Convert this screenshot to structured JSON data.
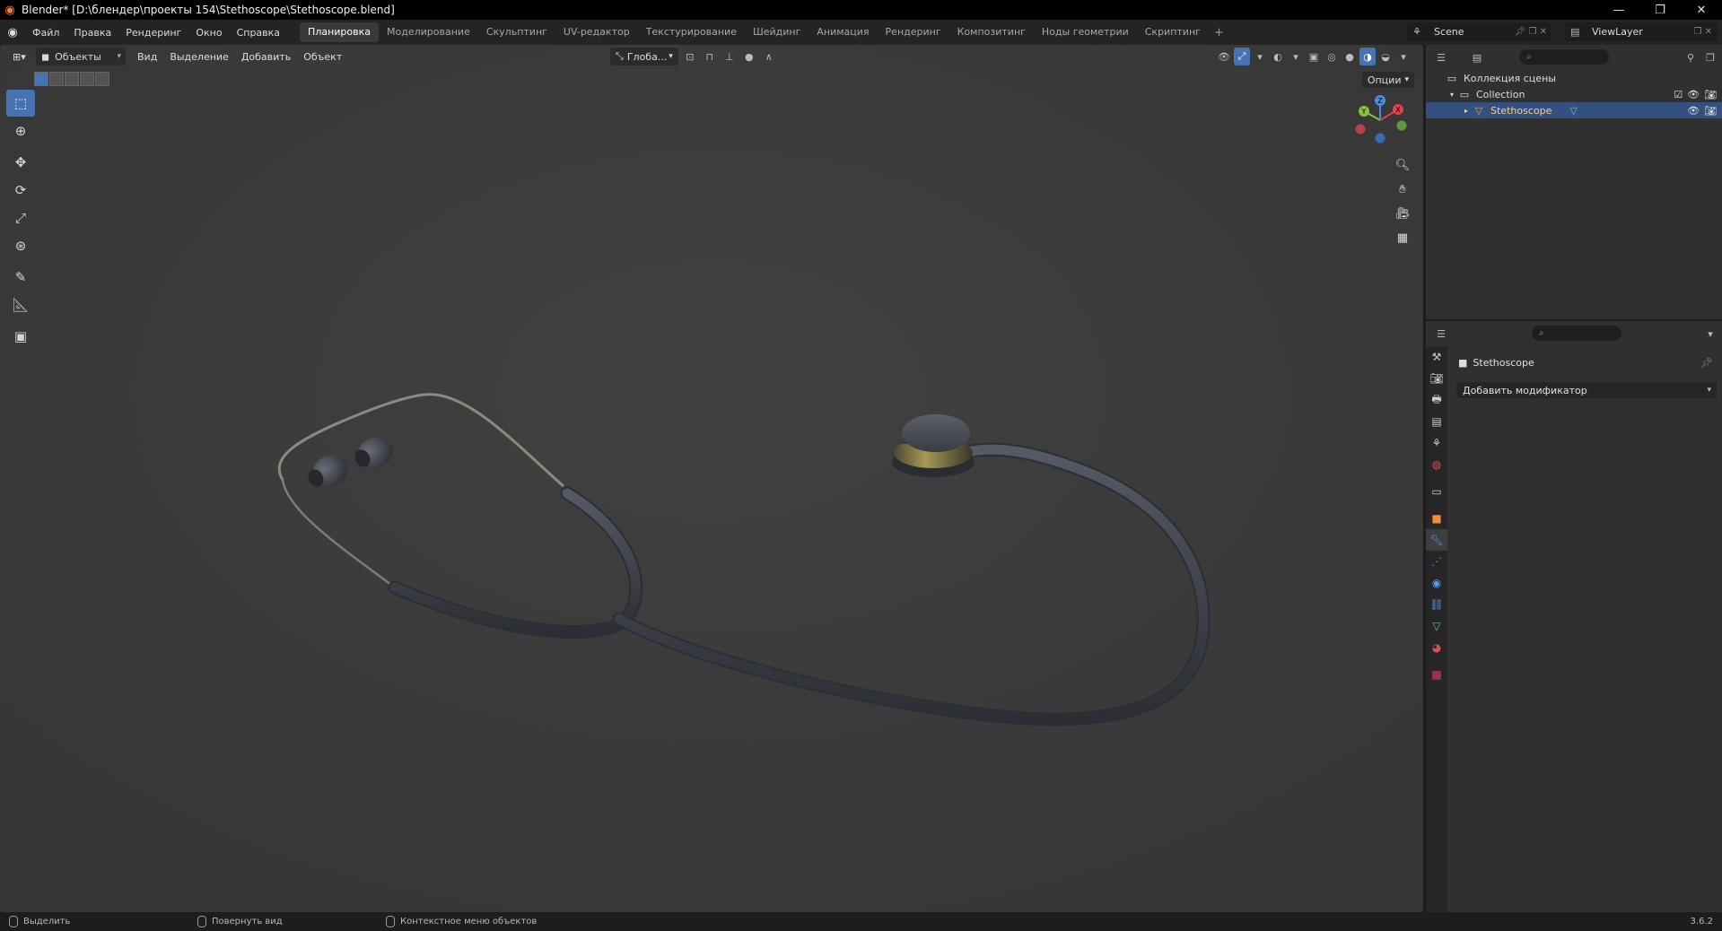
{
  "window": {
    "title": "Blender* [D:\\блендер\\проекты 154\\Stethoscope\\Stethoscope.blend]",
    "minimize": "—",
    "maximize": "❐",
    "close": "✕"
  },
  "menu": [
    "Файл",
    "Правка",
    "Рендеринг",
    "Окно",
    "Справка"
  ],
  "workspaces": [
    "Планировка",
    "Моделирование",
    "Скульптинг",
    "UV-редактор",
    "Текстурирование",
    "Шейдинг",
    "Анимация",
    "Рендеринг",
    "Композитинг",
    "Ноды геометрии",
    "Скриптинг"
  ],
  "active_workspace": "Планировка",
  "add_workspace": "+",
  "scene": "Scene",
  "view_layer": "ViewLayer",
  "viewport": {
    "mode": "Объекты",
    "menus": [
      "Вид",
      "Выделение",
      "Добавить",
      "Объект"
    ],
    "orientation": "Глоба...",
    "options": "Опции"
  },
  "outliner": {
    "root": "Коллекция сцены",
    "collection": "Collection",
    "object": "Stethoscope"
  },
  "properties": {
    "object_name": "Stethoscope",
    "add_modifier": "Добавить модификатор"
  },
  "statusbar": {
    "select": "Выделить",
    "rotate": "Повернуть вид",
    "context": "Контекстное меню объектов",
    "version": "3.6.2"
  },
  "colors": {
    "accent": "#4772b3",
    "selection": "#335080",
    "viewport_bg": "#3d3d3d"
  }
}
